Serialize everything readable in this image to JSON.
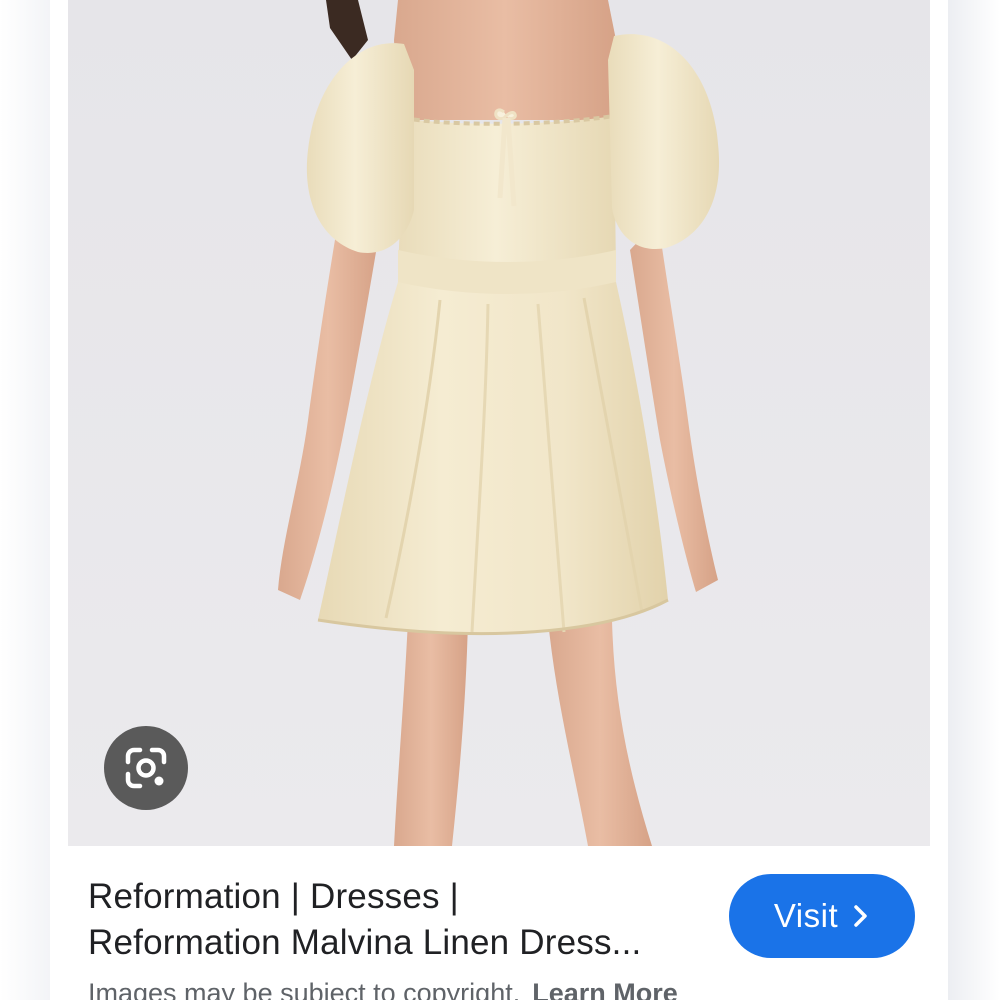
{
  "result": {
    "title_line_1": "Reformation | Dresses |",
    "title_line_2": "Reformation Malvina Linen Dress...",
    "visit_label": "Visit",
    "copyright_text": "Images may be subject to copyright.",
    "learn_more_label": "Learn More"
  },
  "icons": {
    "lens": "google-lens-icon",
    "visit_chevron": "chevron-right-icon"
  },
  "colors": {
    "accent": "#1a73e8",
    "title_text": "#202124",
    "muted_text": "#5f6368",
    "photo_background": "#e8e7ea",
    "dress": "#f3e9cf"
  }
}
